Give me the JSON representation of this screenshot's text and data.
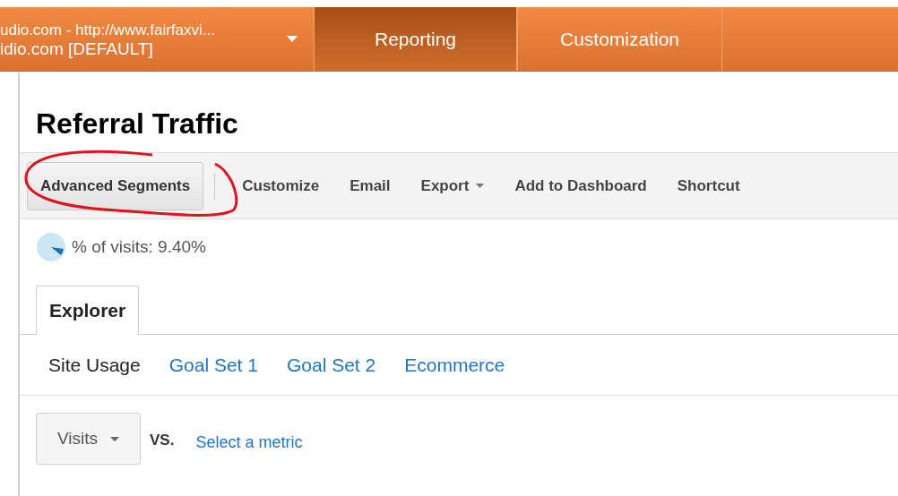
{
  "account": {
    "line_1": "udio.com - http://www.fairfaxvi...",
    "line_2": "idio.com [DEFAULT]"
  },
  "nav_tabs": [
    {
      "label": "Reporting",
      "selected": true
    },
    {
      "label": "Customization",
      "selected": false
    }
  ],
  "page_title": "Referral Traffic",
  "toolbar": [
    {
      "label": "Advanced Segments",
      "kind": "button"
    },
    {
      "label": "Customize",
      "kind": "link"
    },
    {
      "label": "Email",
      "kind": "link"
    },
    {
      "label": "Export",
      "kind": "dropdown"
    },
    {
      "label": "Add to Dashboard",
      "kind": "link"
    },
    {
      "label": "Shortcut",
      "kind": "link"
    }
  ],
  "share": {
    "text": "% of visits: 9.40%"
  },
  "view_tabs": [
    {
      "label": "Explorer",
      "selected": true
    }
  ],
  "metric_groups": [
    {
      "label": "Site Usage",
      "selected": true
    },
    {
      "label": "Goal Set 1",
      "selected": false
    },
    {
      "label": "Goal Set 2",
      "selected": false
    },
    {
      "label": "Ecommerce",
      "selected": false
    }
  ],
  "metric_picker": {
    "value": "Visits",
    "versus": "VS.",
    "link": "Select a metric"
  }
}
